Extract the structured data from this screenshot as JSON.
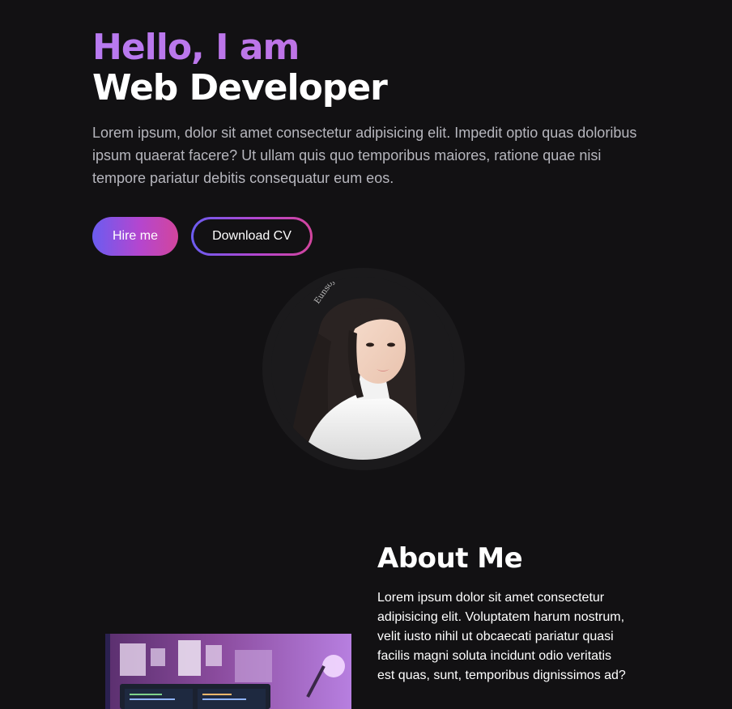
{
  "hero": {
    "greeting": "Hello, I am",
    "role": "Web Developer",
    "description": "Lorem ipsum, dolor sit amet consectetur adipisicing elit. Impedit optio quas doloribus ipsum quaerat facere? Ut ullam quis quo temporibus maiores, ratione quae nisi tempore pariatur debitis consequatur eum eos."
  },
  "buttons": {
    "hire_label": "Hire me",
    "cv_label": "Download CV"
  },
  "colors": {
    "background": "#121113",
    "accent_start": "#6b5cf0",
    "accent_mid": "#b446cf",
    "accent_end": "#d2459d",
    "greeting": "#c270e0"
  },
  "about": {
    "title": "About Me",
    "text": "Lorem ipsum dolor sit amet consectetur adipisicing elit. Voluptatem harum nostrum, velit iusto nihil ut obcaecati pariatur quasi facilis magni soluta incidunt odio veritatis est quas, sunt, temporibus dignissimos ad?"
  },
  "profile_signature": "Eunsoj"
}
